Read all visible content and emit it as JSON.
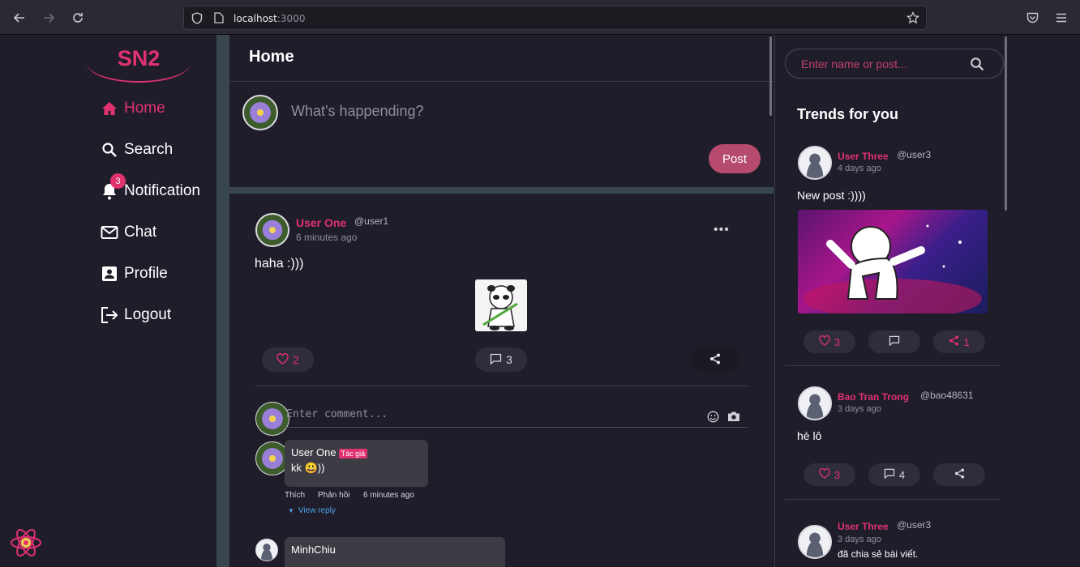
{
  "browser": {
    "url_host": "localhost",
    "url_port": ":3000"
  },
  "sidebar": {
    "logo": "SN2",
    "items": [
      {
        "label": "Home",
        "icon": "home-icon"
      },
      {
        "label": "Search",
        "icon": "search-icon"
      },
      {
        "label": "Notification",
        "icon": "bell-icon",
        "badge": "3"
      },
      {
        "label": "Chat",
        "icon": "mail-icon"
      },
      {
        "label": "Profile",
        "icon": "profile-icon"
      },
      {
        "label": "Logout",
        "icon": "logout-icon"
      }
    ]
  },
  "main": {
    "title": "Home",
    "composer": {
      "placeholder": "What's happending?",
      "post_label": "Post"
    },
    "post": {
      "name": "User One",
      "handle": "@user1",
      "time": "6 minutes ago",
      "text": "haha :)))",
      "likes": "2",
      "comments": "3",
      "comment_placeholder": "Enter comment...",
      "comment_list": [
        {
          "name": "User One",
          "tag": "Tác giả",
          "text": "kk 😃))",
          "like": "Thích",
          "reply": "Phản hồi",
          "time": "6 minutes ago",
          "view_reply": "View reply"
        },
        {
          "name": "MinhChiu"
        }
      ]
    }
  },
  "right": {
    "search_placeholder": "Enter name or post...",
    "trends_title": "Trends for you",
    "trends": [
      {
        "name": "User Three",
        "handle": "@user3",
        "time": "4 days ago",
        "text": "New post :))))",
        "likes": "3",
        "comments": "",
        "shares": "1"
      },
      {
        "name": "Bao Tran Trong",
        "handle": "@bao48631",
        "time": "3 days ago",
        "text": "hè lô",
        "likes": "3",
        "comments": "4",
        "shares": ""
      },
      {
        "name": "User Three",
        "handle": "@user3",
        "time": "3 days ago",
        "text": "đã chia sẻ bài viết."
      }
    ]
  },
  "colors": {
    "accent": "#e0326f",
    "post_button": "#b64b6d",
    "background": "#201d2b"
  }
}
